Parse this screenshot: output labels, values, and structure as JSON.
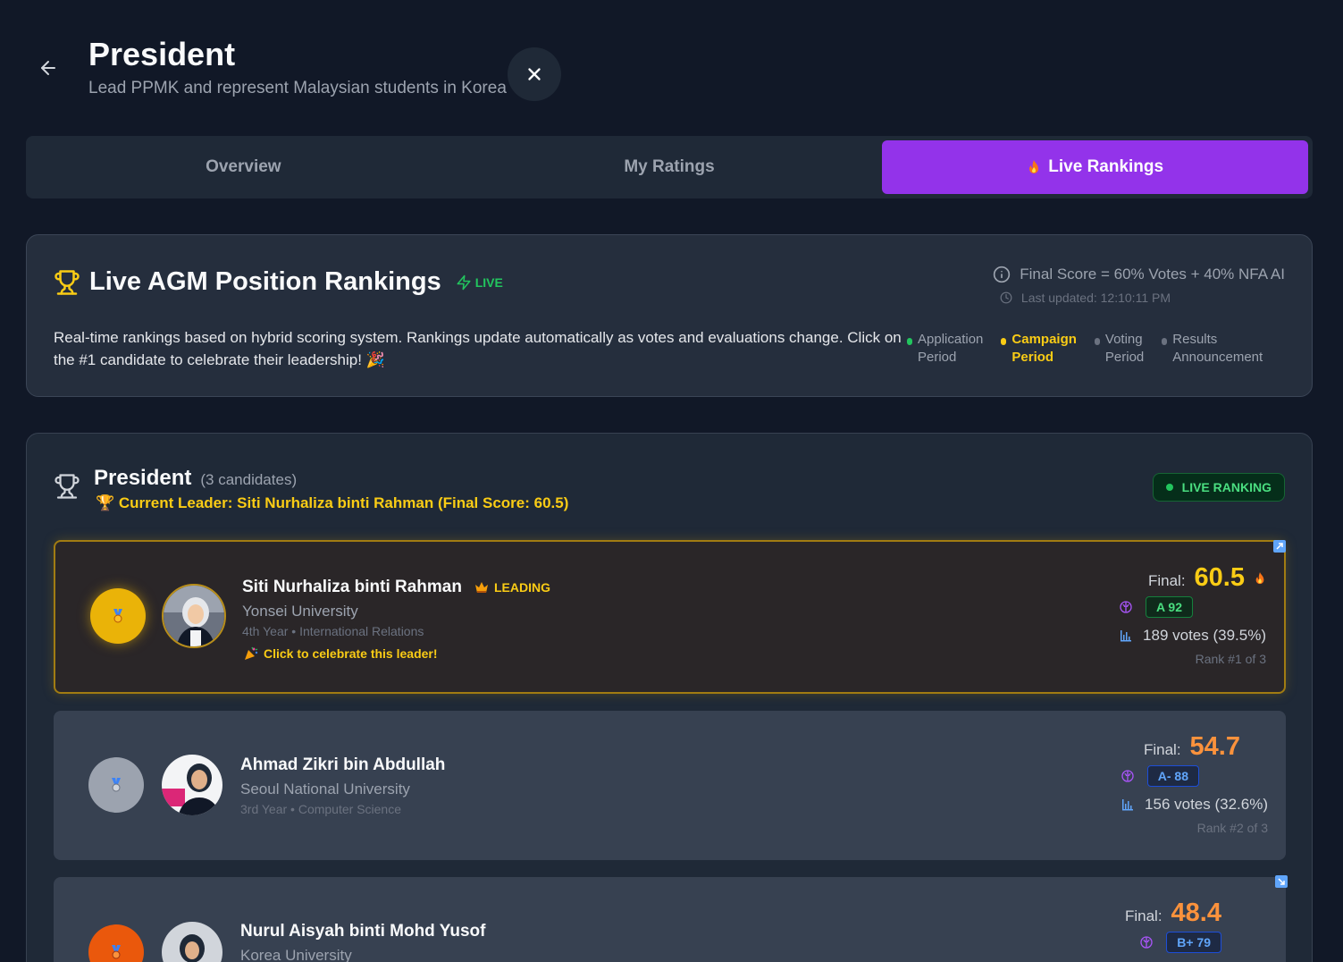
{
  "header": {
    "title": "President",
    "subtitle": "Lead PPMK and represent Malaysian students in Korea"
  },
  "tabs": [
    {
      "label": "Overview",
      "active": false
    },
    {
      "label": "My Ratings",
      "active": false
    },
    {
      "label": "Live Rankings",
      "active": true
    }
  ],
  "info": {
    "title": "Live AGM Position Rankings",
    "live_label": "LIVE",
    "formula": "Final Score = 60% Votes + 40% NFA AI",
    "last_updated": "Last updated: 12:10:11 PM",
    "description": "Real-time rankings based on hybrid scoring system. Rankings update automatically as votes and evaluations change. Click on the #1 candidate to celebrate their leadership! 🎉",
    "phases": [
      {
        "line1": "Application",
        "line2": "Period",
        "color": "#22c55e",
        "current": false
      },
      {
        "line1": "Campaign",
        "line2": "Period",
        "color": "#facc15",
        "current": true
      },
      {
        "line1": "Voting",
        "line2": "Period",
        "color": "#6b7280",
        "current": false
      },
      {
        "line1": "Results",
        "line2": "Announcement",
        "color": "#6b7280",
        "current": false
      }
    ]
  },
  "position": {
    "title": "President",
    "count": "(3 candidates)",
    "leader_line": "🏆 Current Leader: Siti Nurhaliza binti Rahman (Final Score: 60.5)",
    "badge": "LIVE RANKING"
  },
  "candidates": [
    {
      "name": "Siti Nurhaliza binti Rahman",
      "leading_label": "LEADING",
      "university": "Yonsei University",
      "year": "4th Year • International Relations",
      "celebrate": "Click to celebrate this leader!",
      "final_label": "Final:",
      "final_score": "60.5",
      "grade": "A 92",
      "votes": "189 votes (39.5%)",
      "rank": "Rank #1 of 3"
    },
    {
      "name": "Ahmad Zikri bin Abdullah",
      "university": "Seoul National University",
      "year": "3rd Year • Computer Science",
      "final_label": "Final:",
      "final_score": "54.7",
      "grade": "A- 88",
      "votes": "156 votes (32.6%)",
      "rank": "Rank #2 of 3"
    },
    {
      "name": "Nurul Aisyah binti Mohd Yusof",
      "university": "Korea University",
      "final_label": "Final:",
      "final_score": "48.4",
      "grade": "B+ 79"
    }
  ],
  "colors": {
    "accent": "#9333ea",
    "gold": "#facc15",
    "orange": "#fb923c",
    "live_green": "#22c55e"
  }
}
